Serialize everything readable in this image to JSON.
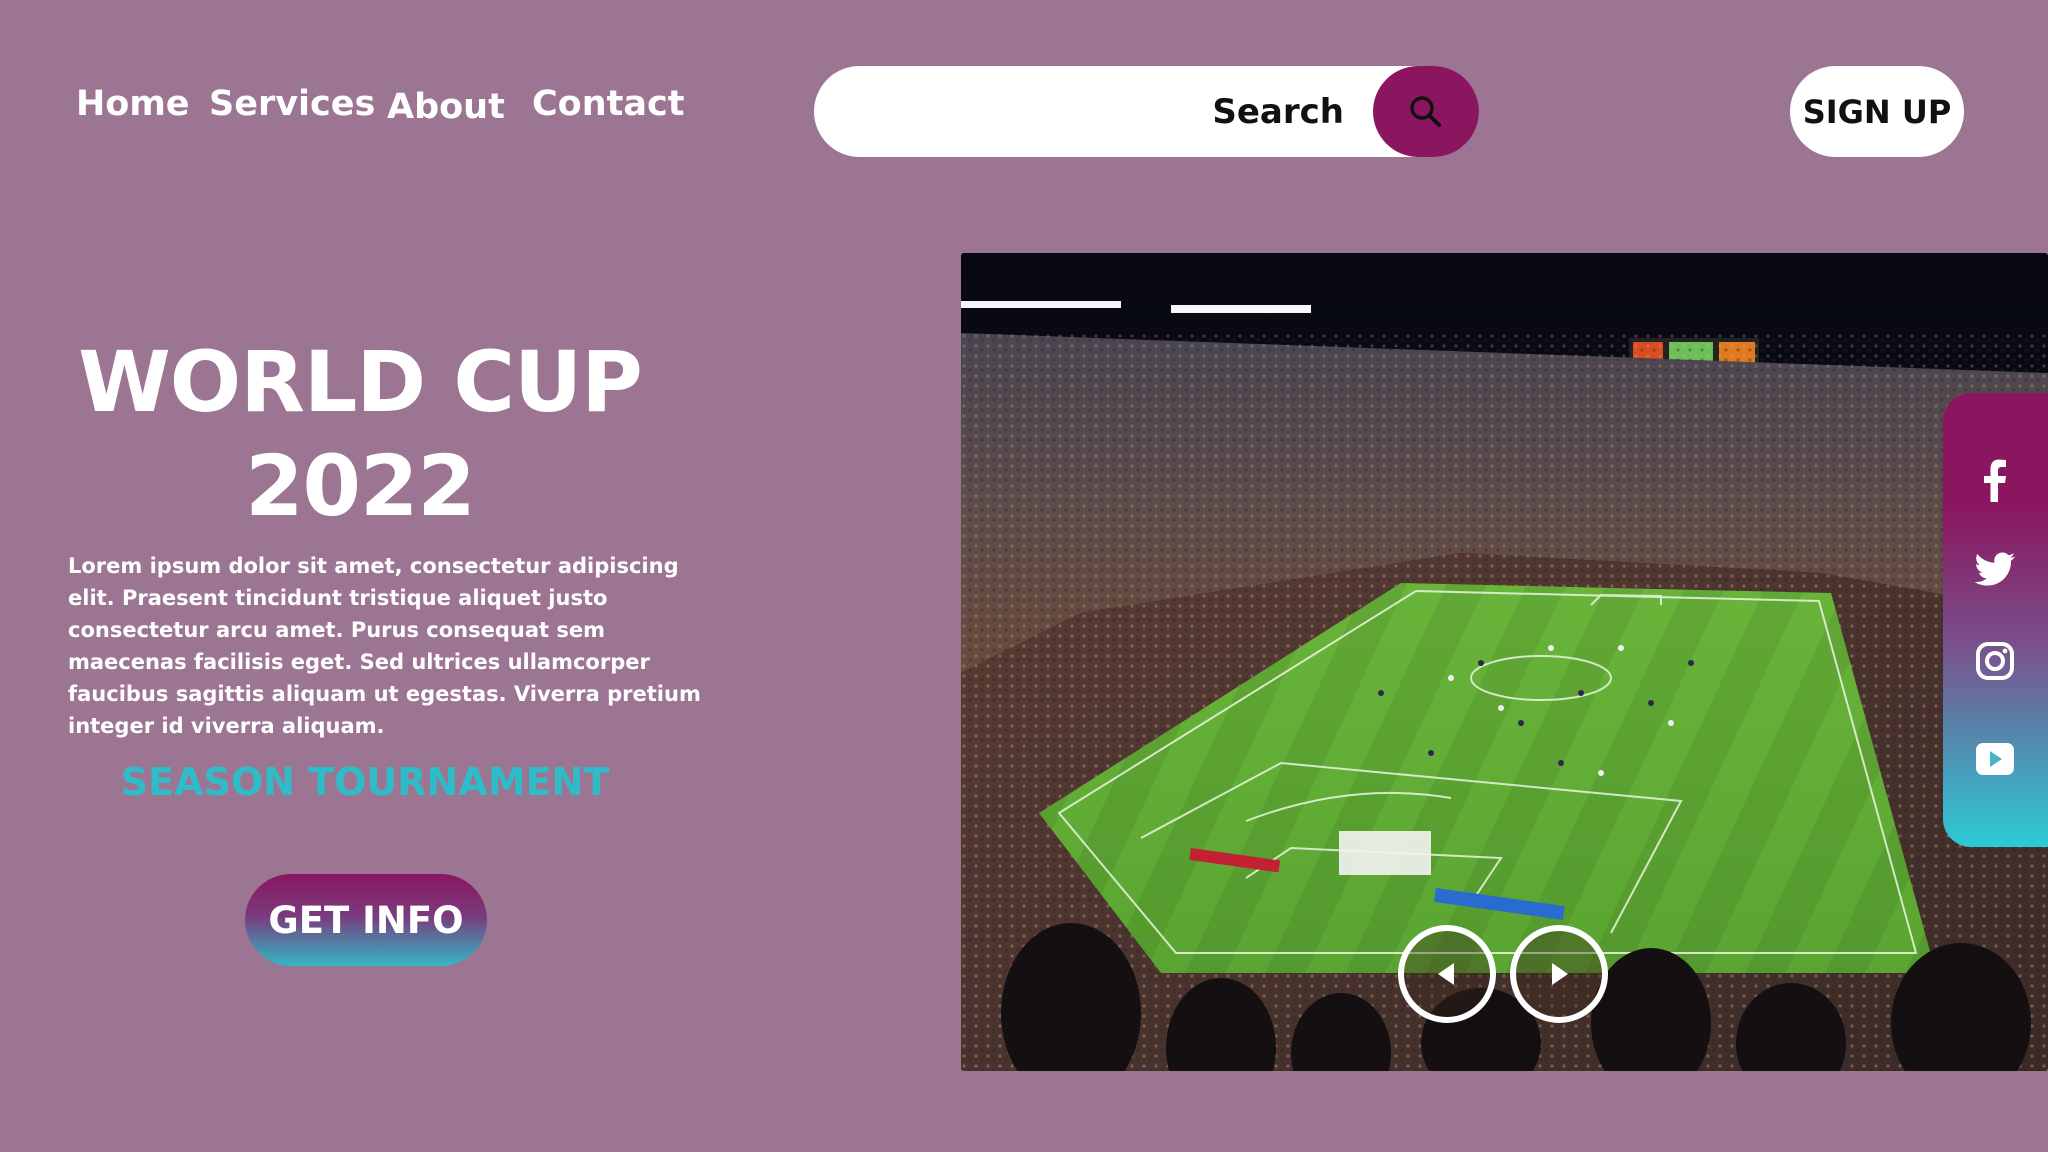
{
  "nav": {
    "home": "Home",
    "services": "Services",
    "about": "About",
    "contact": "Contact"
  },
  "search": {
    "placeholder": "Search"
  },
  "signup_label": "SIGN UP",
  "hero": {
    "title_line1": "WORLD CUP",
    "title_line2": "2022",
    "description": "Lorem ipsum dolor sit amet, consectetur adipiscing elit. Praesent tincidunt tristique aliquet justo consectetur arcu amet. Purus consequat sem maecenas facilisis eget. Sed ultrices ullamcorper faucibus sagittis aliquam ut egestas. Viverra pretium integer id viverra aliquam.",
    "subtitle": "SEASON TOURNAMENT",
    "cta_label": "GET INFO"
  },
  "social": [
    "facebook-icon",
    "twitter-icon",
    "instagram-icon",
    "youtube-icon"
  ],
  "colors": {
    "background": "#9c7593",
    "accent": "#8a1660",
    "teal": "#2fbcc9"
  }
}
